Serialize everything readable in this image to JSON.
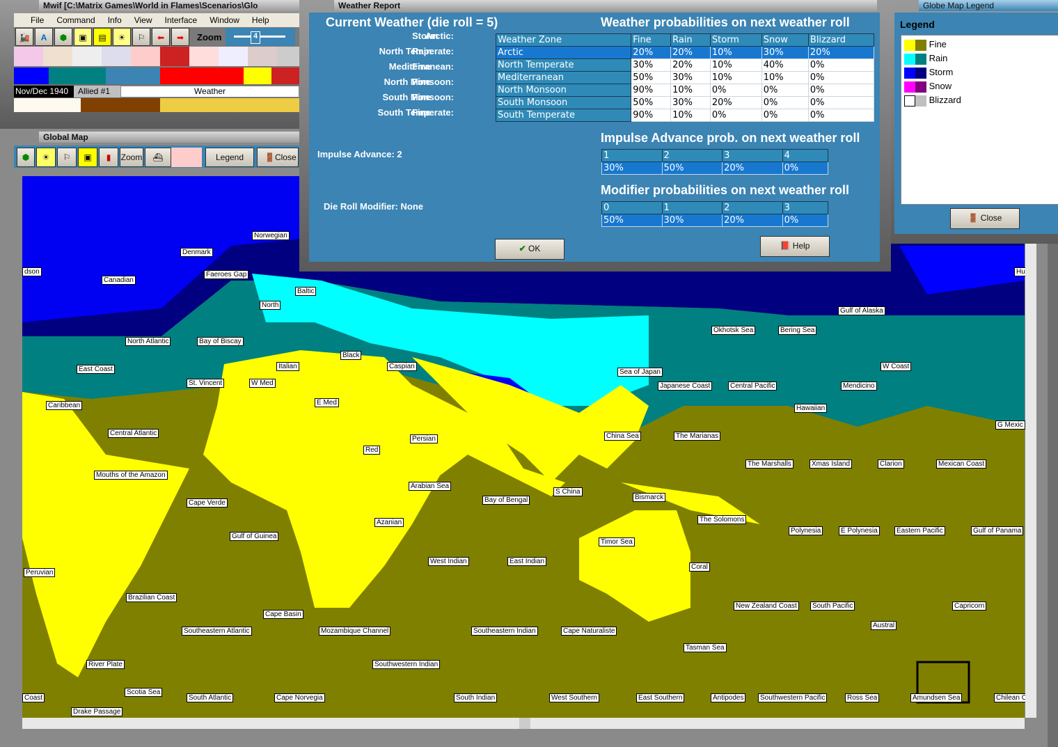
{
  "main_window": {
    "title": "Mwif [C:\\Matrix Games\\World in Flames\\Scenarios\\Glo",
    "menu": [
      "File",
      "Command",
      "Info",
      "View",
      "Interface",
      "Window",
      "Help"
    ],
    "zoom_label": "Zoom",
    "zoom_value": "4",
    "date": "Nov/Dec 1940",
    "turn": "Allied #1",
    "phase": "Weather"
  },
  "global_map": {
    "title": "Global Map",
    "zoom_button": "Zoom",
    "legend_button": "Legend",
    "close_button": "Close",
    "zones": [
      [
        "Norwegian",
        362,
        332
      ],
      [
        "Denmark",
        259,
        356
      ],
      [
        "dson",
        32,
        384
      ],
      [
        "Canadian",
        146,
        396
      ],
      [
        "Faeroes Gap",
        293,
        388
      ],
      [
        "Baltic",
        424,
        412
      ],
      [
        "North",
        373,
        432
      ],
      [
        "North Atlantic",
        180,
        484
      ],
      [
        "Bay of Biscay",
        283,
        484
      ],
      [
        "Black",
        489,
        504
      ],
      [
        "Caspian",
        556,
        520
      ],
      [
        "Italian",
        397,
        520
      ],
      [
        "East Coast",
        110,
        524
      ],
      [
        "St. Vincent",
        268,
        544
      ],
      [
        "W Med",
        358,
        544
      ],
      [
        "E Med",
        452,
        572
      ],
      [
        "Caribbean",
        66,
        576
      ],
      [
        "Central Atlantic",
        155,
        616
      ],
      [
        "Persian",
        589,
        624
      ],
      [
        "Red",
        522,
        640
      ],
      [
        "Mouths of the Amazon",
        135,
        676
      ],
      [
        "Arabian Sea",
        587,
        692
      ],
      [
        "Cape Verde",
        268,
        716
      ],
      [
        "Bay of Bengal",
        693,
        712
      ],
      [
        "S China",
        795,
        700
      ],
      [
        "Azanian",
        538,
        744
      ],
      [
        "Gulf of Guinea",
        330,
        764
      ],
      [
        "West Indian",
        615,
        800
      ],
      [
        "East Indian",
        729,
        800
      ],
      [
        "Peruvian",
        34,
        816
      ],
      [
        "Brazilian Coast",
        181,
        852
      ],
      [
        "Cape Basin",
        378,
        876
      ],
      [
        "Southeastern Atlantic",
        261,
        900
      ],
      [
        "Mozambique Channel",
        458,
        900
      ],
      [
        "Southeastern Indian",
        677,
        900
      ],
      [
        "Cape Naturaliste",
        806,
        900
      ],
      [
        "Southwestern Indian",
        535,
        948
      ],
      [
        "River Plate",
        124,
        948
      ],
      [
        "Scotia Sea",
        179,
        988
      ],
      [
        "Coast",
        32,
        996
      ],
      [
        "South Atlantic",
        268,
        996
      ],
      [
        "Cape Norvegia",
        394,
        996
      ],
      [
        "South Indian",
        652,
        996
      ],
      [
        "West Southern",
        789,
        996
      ],
      [
        "East Southern",
        914,
        996
      ],
      [
        "Antipodes",
        1021,
        996
      ],
      [
        "Southwestern Pacific",
        1089,
        996
      ],
      [
        "Ross Sea",
        1214,
        996
      ],
      [
        "Amundsen Sea",
        1308,
        996
      ],
      [
        "Chilean C",
        1428,
        996
      ],
      [
        "Drake Passage",
        102,
        1016
      ],
      [
        "Gulf of Alaska",
        1204,
        440
      ],
      [
        "Okhotsk Sea",
        1022,
        468
      ],
      [
        "Bering Sea",
        1118,
        468
      ],
      [
        "Sea of Japan",
        887,
        528
      ],
      [
        "W Coast",
        1265,
        520
      ],
      [
        "Japanese Coast",
        945,
        548
      ],
      [
        "Central Pacific",
        1046,
        548
      ],
      [
        "Mendicino",
        1208,
        548
      ],
      [
        "Hawaiian",
        1141,
        580
      ],
      [
        "G Mexic",
        1430,
        604
      ],
      [
        "China Sea",
        868,
        620
      ],
      [
        "The Marianas",
        968,
        620
      ],
      [
        "The Marshalls",
        1071,
        660
      ],
      [
        "Xmas Island",
        1163,
        660
      ],
      [
        "Clarion",
        1261,
        660
      ],
      [
        "Mexican Coast",
        1345,
        660
      ],
      [
        "Bismarck",
        909,
        708
      ],
      [
        "The Solomons",
        1002,
        740
      ],
      [
        "Polynesia",
        1133,
        756
      ],
      [
        "E Polynesia",
        1205,
        756
      ],
      [
        "Eastern Pacific",
        1285,
        756
      ],
      [
        "Gulf of Panama",
        1395,
        756
      ],
      [
        "Timor Sea",
        860,
        772
      ],
      [
        "Coral",
        990,
        808
      ],
      [
        "New Zealand Coast",
        1054,
        864
      ],
      [
        "South Pacific",
        1164,
        864
      ],
      [
        "Capricorn",
        1368,
        864
      ],
      [
        "Austral",
        1251,
        892
      ],
      [
        "Tasman Sea",
        982,
        924
      ],
      [
        "Hu",
        1457,
        384
      ]
    ]
  },
  "weather_report": {
    "title": "Weather Report",
    "current_title": "Current Weather (die roll = 5)",
    "current": [
      {
        "zone": "Arctic:",
        "value": "Storm"
      },
      {
        "zone": "North Temperate:",
        "value": "Rain"
      },
      {
        "zone": "Mediterranean:",
        "value": "Fine"
      },
      {
        "zone": "North Monsoon:",
        "value": "Fine"
      },
      {
        "zone": "South Monsoon:",
        "value": "Fine"
      },
      {
        "zone": "South Temperate:",
        "value": "Fine"
      }
    ],
    "impulse_label": "Impulse Advance:",
    "impulse_value": "2",
    "modifier_label": "Die Roll Modifier:",
    "modifier_value": "None",
    "prob_title": "Weather probabilities on next weather roll",
    "prob_headers": [
      "Weather Zone",
      "Fine",
      "Rain",
      "Storm",
      "Snow",
      "Blizzard"
    ],
    "prob_rows": [
      [
        "Arctic",
        "20%",
        "20%",
        "10%",
        "30%",
        "20%"
      ],
      [
        "North Temperate",
        "30%",
        "20%",
        "10%",
        "40%",
        "0%"
      ],
      [
        "Mediterranean",
        "50%",
        "30%",
        "10%",
        "10%",
        "0%"
      ],
      [
        "North Monsoon",
        "90%",
        "10%",
        "0%",
        "0%",
        "0%"
      ],
      [
        "South Monsoon",
        "50%",
        "30%",
        "20%",
        "0%",
        "0%"
      ],
      [
        "South Temperate",
        "90%",
        "10%",
        "0%",
        "0%",
        "0%"
      ]
    ],
    "impulse_title": "Impulse Advance prob. on next weather roll",
    "impulse_headers": [
      "1",
      "2",
      "3",
      "4"
    ],
    "impulse_values": [
      "30%",
      "50%",
      "20%",
      "0%"
    ],
    "mod_title": "Modifier probabilities on next weather roll",
    "mod_headers": [
      "0",
      "1",
      "2",
      "3"
    ],
    "mod_values": [
      "50%",
      "30%",
      "20%",
      "0%"
    ],
    "ok_button": "OK",
    "help_button": "Help"
  },
  "legend": {
    "title": "Globe Map Legend",
    "heading": "Legend",
    "close_button": "Close",
    "items": [
      {
        "label": "Fine",
        "colors": [
          "#ffff00",
          "#808000"
        ]
      },
      {
        "label": "Rain",
        "colors": [
          "#00ffff",
          "#008080"
        ]
      },
      {
        "label": "Storm",
        "colors": [
          "#0000ff",
          "#000080"
        ]
      },
      {
        "label": "Snow",
        "colors": [
          "#ff00ff",
          "#800080"
        ]
      },
      {
        "label": "Blizzard",
        "colors": [
          "#ffffff",
          "#c0c0c0"
        ]
      }
    ]
  }
}
